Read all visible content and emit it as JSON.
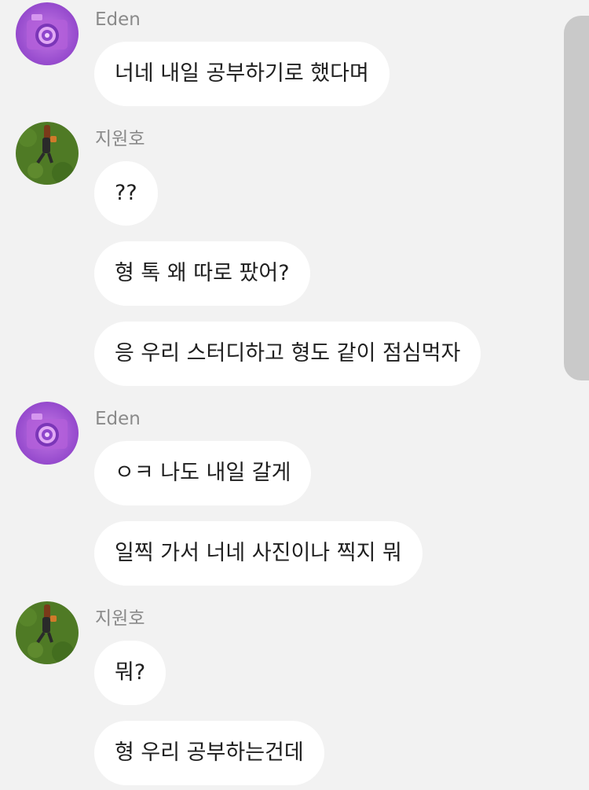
{
  "colors": {
    "background": "#f2f2f2",
    "bubble": "#ffffff",
    "sender_name": "#8a8a8a",
    "message_text": "#1f1f1f",
    "scrollbar": "#c9c9c9"
  },
  "chat": {
    "groups": [
      {
        "sender": "Eden",
        "avatar": "camera-photo-avatar",
        "messages": [
          "너네 내일 공부하기로 했다며"
        ]
      },
      {
        "sender": "지원호",
        "avatar": "grass-photo-avatar",
        "messages": [
          "??",
          "형 톡 왜 따로 팠어?",
          "응 우리 스터디하고 형도 같이 점심먹자"
        ]
      },
      {
        "sender": "Eden",
        "avatar": "camera-photo-avatar",
        "messages": [
          "ㅇㅋ 나도 내일 갈게",
          "일찍 가서 너네 사진이나 찍지 뭐"
        ]
      },
      {
        "sender": "지원호",
        "avatar": "grass-photo-avatar",
        "messages": [
          "뭐?",
          "형 우리 공부하는건데"
        ]
      }
    ]
  }
}
